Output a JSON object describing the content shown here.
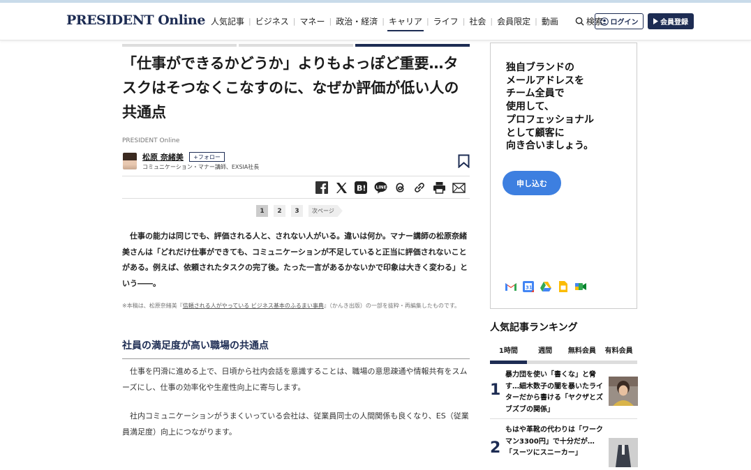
{
  "header": {
    "logo": "PRESIDENT Online",
    "nav": [
      "人気記事",
      "ビジネス",
      "マネー",
      "政治・経済",
      "キャリア",
      "ライフ",
      "社会",
      "会員限定",
      "動画"
    ],
    "nav_active": "キャリア",
    "search_label": "検索",
    "login_label": "ログイン",
    "register_label": "会員登録",
    "brand_color": "#1d2c53"
  },
  "article": {
    "title": "「仕事ができるかどうか」よりもよっぽど重要…タスクはそつなくこなすのに、なぜか評価が低い人の共通点",
    "source": "PRESIDENT Online",
    "author": "松原 奈緒美",
    "follow_label": "+フォロー",
    "author_desc": "コミュニケーション・マナー講師、EXSIA社長",
    "share_icons": [
      "facebook-icon",
      "x-icon",
      "hatena-icon",
      "line-icon",
      "threads-icon",
      "link-icon",
      "print-icon",
      "mail-icon"
    ],
    "pages": [
      "1",
      "2",
      "3"
    ],
    "current_page": "1",
    "next_label": "次ページ",
    "lead": "　仕事の能力は同じでも、評価される人と、されない人がいる。違いは何か。マナー講師の松原奈緒美さんは「どれだけ仕事ができても、コミュニケーションが不足していると正当に評価されないことがある。例えば、依頼されたタスクの完了後。たった一言があるかないかで印象は大きく変わる」という――。",
    "note_prefix": "※本稿は、松原奈緒美『",
    "note_book": "信頼される人がやっている ビジネス基本のふるまい事典",
    "note_suffix": "』（かんき出版）の一部を抜粋・再編集したものです。",
    "heading": "社員の満足度が高い職場の共通点",
    "paragraphs": [
      "　仕事を円滑に進める上で、日頃から社内会話を意識することは、職場の意思疎通や情報共有をスムーズにし、仕事の効率化や生産性向上に寄与します。",
      "　社内コミュニケーションがうまくいっている会社は、従業員同士の人間関係も良くなり、ES（従業員満足度）向上につながります。"
    ]
  },
  "ad": {
    "text": "独自ブランドの\nメールアドレスを\nチーム全員で\n使用して、\nプロフェッショナル\nとして顧客に\n向き合いましょう。",
    "button": "申し込む",
    "app_icons": [
      "gmail-icon",
      "calendar-icon",
      "drive-icon",
      "docs-icon",
      "meet-icon"
    ]
  },
  "ranking": {
    "title": "人気記事ランキング",
    "tabs": [
      "1時間",
      "週間",
      "無料会員",
      "有料会員"
    ],
    "active_tab": "1時間",
    "items": [
      {
        "rank": "1",
        "text": "暴力団を使い「書くな」と脅す…細木数子の闇を暴いたライターだから書ける「ヤクザとズブズブの関係」"
      },
      {
        "rank": "2",
        "text": "もはや革靴の代わりは「ワークマン3300円」で十分だが…「スーツにスニーカー」"
      }
    ]
  }
}
